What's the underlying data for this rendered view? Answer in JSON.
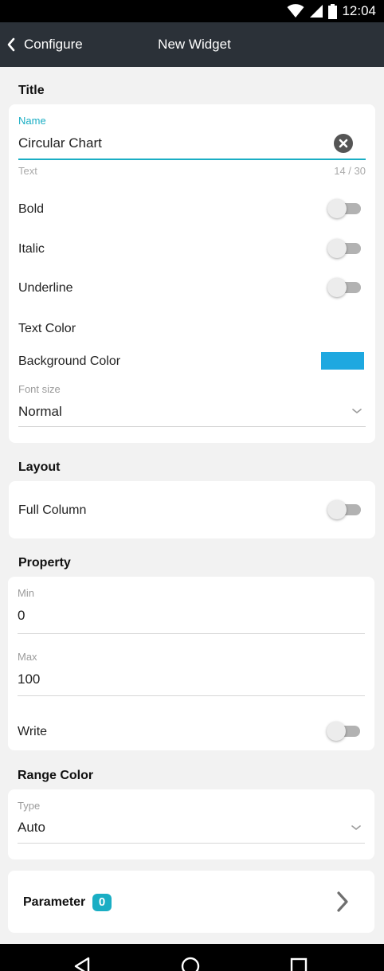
{
  "status_bar": {
    "time": "12:04",
    "icons": [
      "wifi-icon",
      "cell-signal-icon",
      "battery-icon"
    ]
  },
  "app_bar": {
    "back_label": "Configure",
    "title": "New Widget"
  },
  "title_section": {
    "heading": "Title",
    "name_label": "Name",
    "name_value": "Circular Chart",
    "helper_text": "Text",
    "char_count": "14 / 30",
    "bold_label": "Bold",
    "italic_label": "Italic",
    "underline_label": "Underline",
    "text_color_label": "Text Color",
    "background_color_label": "Background Color",
    "background_color": "#1ea8e0",
    "font_size_label": "Font size",
    "font_size_value": "Normal"
  },
  "layout_section": {
    "heading": "Layout",
    "full_column_label": "Full Column"
  },
  "property_section": {
    "heading": "Property",
    "min_label": "Min",
    "min_value": "0",
    "max_label": "Max",
    "max_value": "100",
    "write_label": "Write"
  },
  "range_color_section": {
    "heading": "Range Color",
    "type_label": "Type",
    "type_value": "Auto"
  },
  "parameter": {
    "label": "Parameter",
    "count": "0"
  },
  "colors": {
    "accent": "#1aaec4",
    "app_bar": "#2b3138",
    "background": "#f2f2f2"
  }
}
